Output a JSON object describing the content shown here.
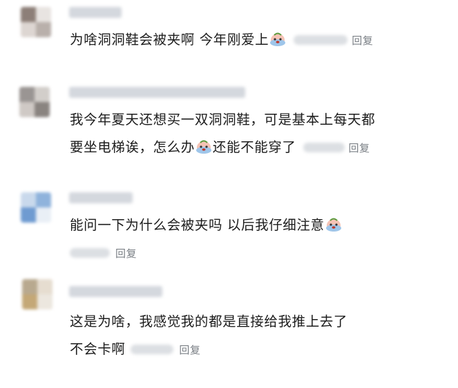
{
  "comments": [
    {
      "text_lines": [
        "为啥洞洞鞋会被夹啊 今年刚爱上"
      ],
      "emoji": "crying-face-icon",
      "reply_label": "回复"
    },
    {
      "text_lines": [
        "我今年夏天还想买一双洞洞鞋，可是基本上每天都",
        "要坐电梯诶，怎么办",
        "还能不能穿了"
      ],
      "emoji": "crying-face-icon",
      "reply_label": "回复"
    },
    {
      "text_lines": [
        "能问一下为什么会被夹吗 以后我仔细注意"
      ],
      "emoji": "crying-face-icon",
      "reply_label": "回复"
    },
    {
      "text_lines": [
        "这是为啥，我感觉我的都是直接给我推上去了",
        "不会卡啊"
      ],
      "reply_label": "回复"
    }
  ],
  "colors": {
    "text": "#1c1c1c",
    "reply": "#7a7f85",
    "blur_placeholder": "#d4d8de"
  }
}
